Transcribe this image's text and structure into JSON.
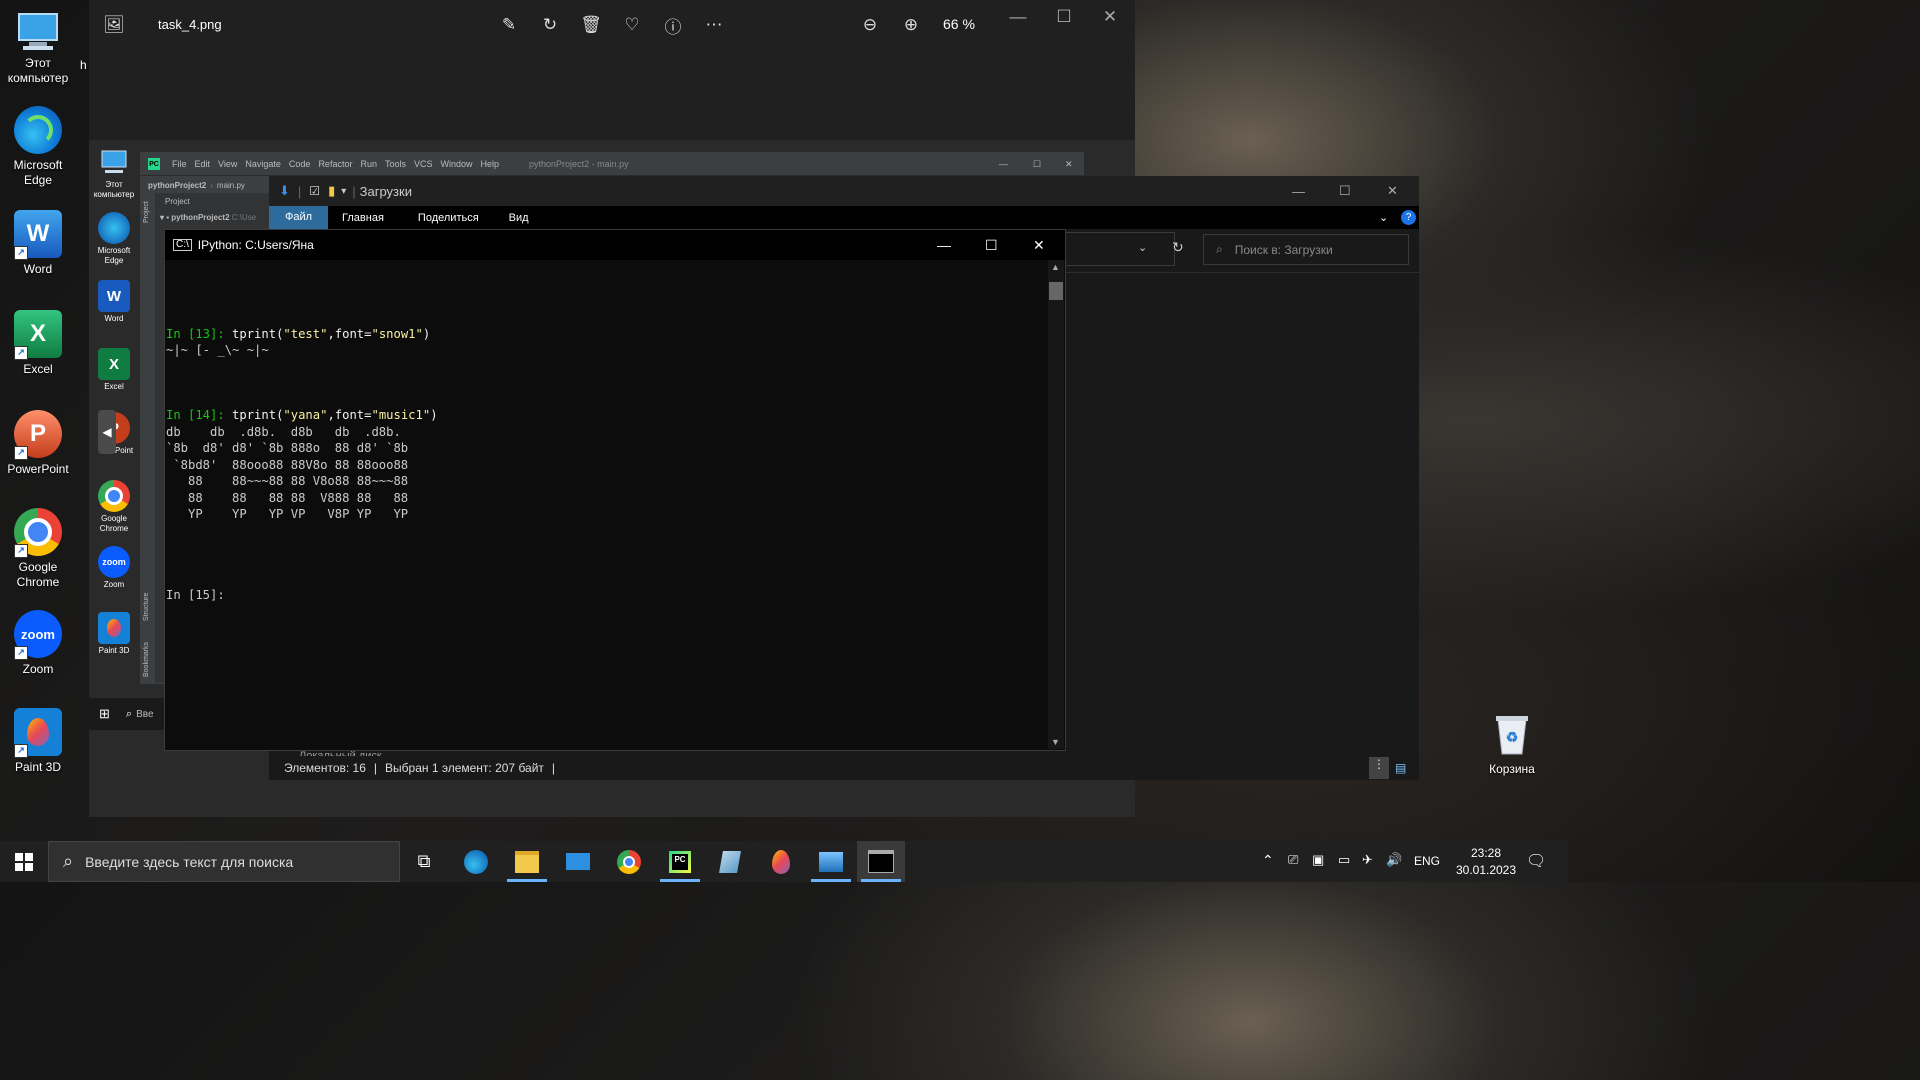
{
  "desktop": {
    "icons": [
      {
        "label": "Этот\nкомпьютер"
      },
      {
        "label": "Microsoft\nEdge"
      },
      {
        "label": "Word"
      },
      {
        "label": "Excel"
      },
      {
        "label": "PowerPoint"
      },
      {
        "label": "Google\nChrome"
      },
      {
        "label": "Zoom"
      },
      {
        "label": "Paint 3D"
      },
      {
        "label": "Корзина"
      }
    ],
    "partial_label": "h"
  },
  "photos": {
    "filename": "task_4.png",
    "zoom": "66 %"
  },
  "inner_screenshot": {
    "icons": [
      "Этот\nкомпьютер",
      "Microsoft\nEdge",
      "Word",
      "Excel",
      "Point",
      "Google\nChrome",
      "Zoom",
      "Paint 3D"
    ],
    "search_placeholder": "Вве"
  },
  "pycharm": {
    "menu": [
      "File",
      "Edit",
      "View",
      "Navigate",
      "Code",
      "Refactor",
      "Run",
      "Tools",
      "VCS",
      "Window",
      "Help"
    ],
    "title": "pythonProject2 - main.py",
    "breadcrumb_project": "pythonProject2",
    "breadcrumb_file": "main.py",
    "project_label": "Project",
    "tree_root": "pythonProject2",
    "tree_path": "C:\\Use",
    "side_tabs": [
      "Project",
      "Structure",
      "Bookmarks"
    ]
  },
  "explorer": {
    "title": "Загрузки",
    "tabs": [
      "Файл",
      "Главная",
      "Поделиться",
      "Вид"
    ],
    "search_placeholder": "Поиск в: Загрузки",
    "status_items": "Элементов: 16",
    "status_selected": "Выбран 1 элемент: 207 байт",
    "bottom_partial": "Локальный диск"
  },
  "terminal": {
    "title": "IPython: C:Users/Яна",
    "lines": [
      {
        "prompt": "In [13]: ",
        "code": "tprint(",
        "str1": "\"test\"",
        "mid": ",font=",
        "str2": "\"snow1\"",
        "end": ")"
      },
      {
        "prompt": "In [14]: ",
        "code": "tprint(",
        "str1": "\"yana\"",
        "mid": ",font=",
        "str2": "\"music1\"",
        "end": ")"
      }
    ],
    "output1": "~|~ [- _\\~ ~|~",
    "output2": "db    db  .d8b.  d8b   db  .d8b.\n`8b  d8' d8' `8b 888o  88 d8' `8b\n `8bd8'  88ooo88 88V8o 88 88ooo88\n   88    88~~~88 88 V8o88 88~~~88\n   88    88   88 88  V888 88   88\n   YP    YP   YP VP   V8P YP   YP",
    "prompt_next": "In [15]:"
  },
  "taskbar": {
    "search_placeholder": "Введите здесь текст для поиска",
    "language": "ENG",
    "time": "23:28",
    "date": "30.01.2023"
  }
}
